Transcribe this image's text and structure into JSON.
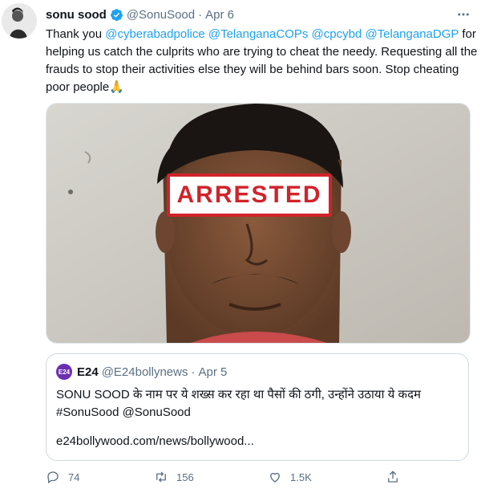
{
  "tweet": {
    "author": {
      "name": "sonu sood",
      "handle": "@SonuSood",
      "verified": true
    },
    "date": "Apr 6",
    "text_parts": {
      "t1": "Thank you ",
      "m1": "@cyberabadpolice",
      "m2": "@TelanganaCOPs",
      "m3": "@cpcybd",
      "m4": "@TelanganaDGP",
      "t2": "for helping us catch the culprits who are trying to cheat the needy. Requesting all the frauds to stop their activities else they will be behind bars soon. Stop cheating poor people",
      "emoji": "🙏"
    },
    "image": {
      "stamp_text": "ARRESTED"
    }
  },
  "quote": {
    "avatar_label": "E24",
    "name": "E24",
    "handle": "@E24bollynews",
    "date": "Apr 5",
    "text_line1": "SONU SOOD के नाम पर ये शख्स कर रहा था पैसों की ठगी, उन्होंने उठाया ये कदम",
    "text_line2": "#SonuSood @SonuSood",
    "link": "e24bollywood.com/news/bollywood..."
  },
  "actions": {
    "reply_count": "74",
    "retweet_count": "156",
    "like_count": "1.5K"
  },
  "colors": {
    "accent": "#1da1f2",
    "stamp": "#d0232a",
    "muted": "#5b7083"
  }
}
